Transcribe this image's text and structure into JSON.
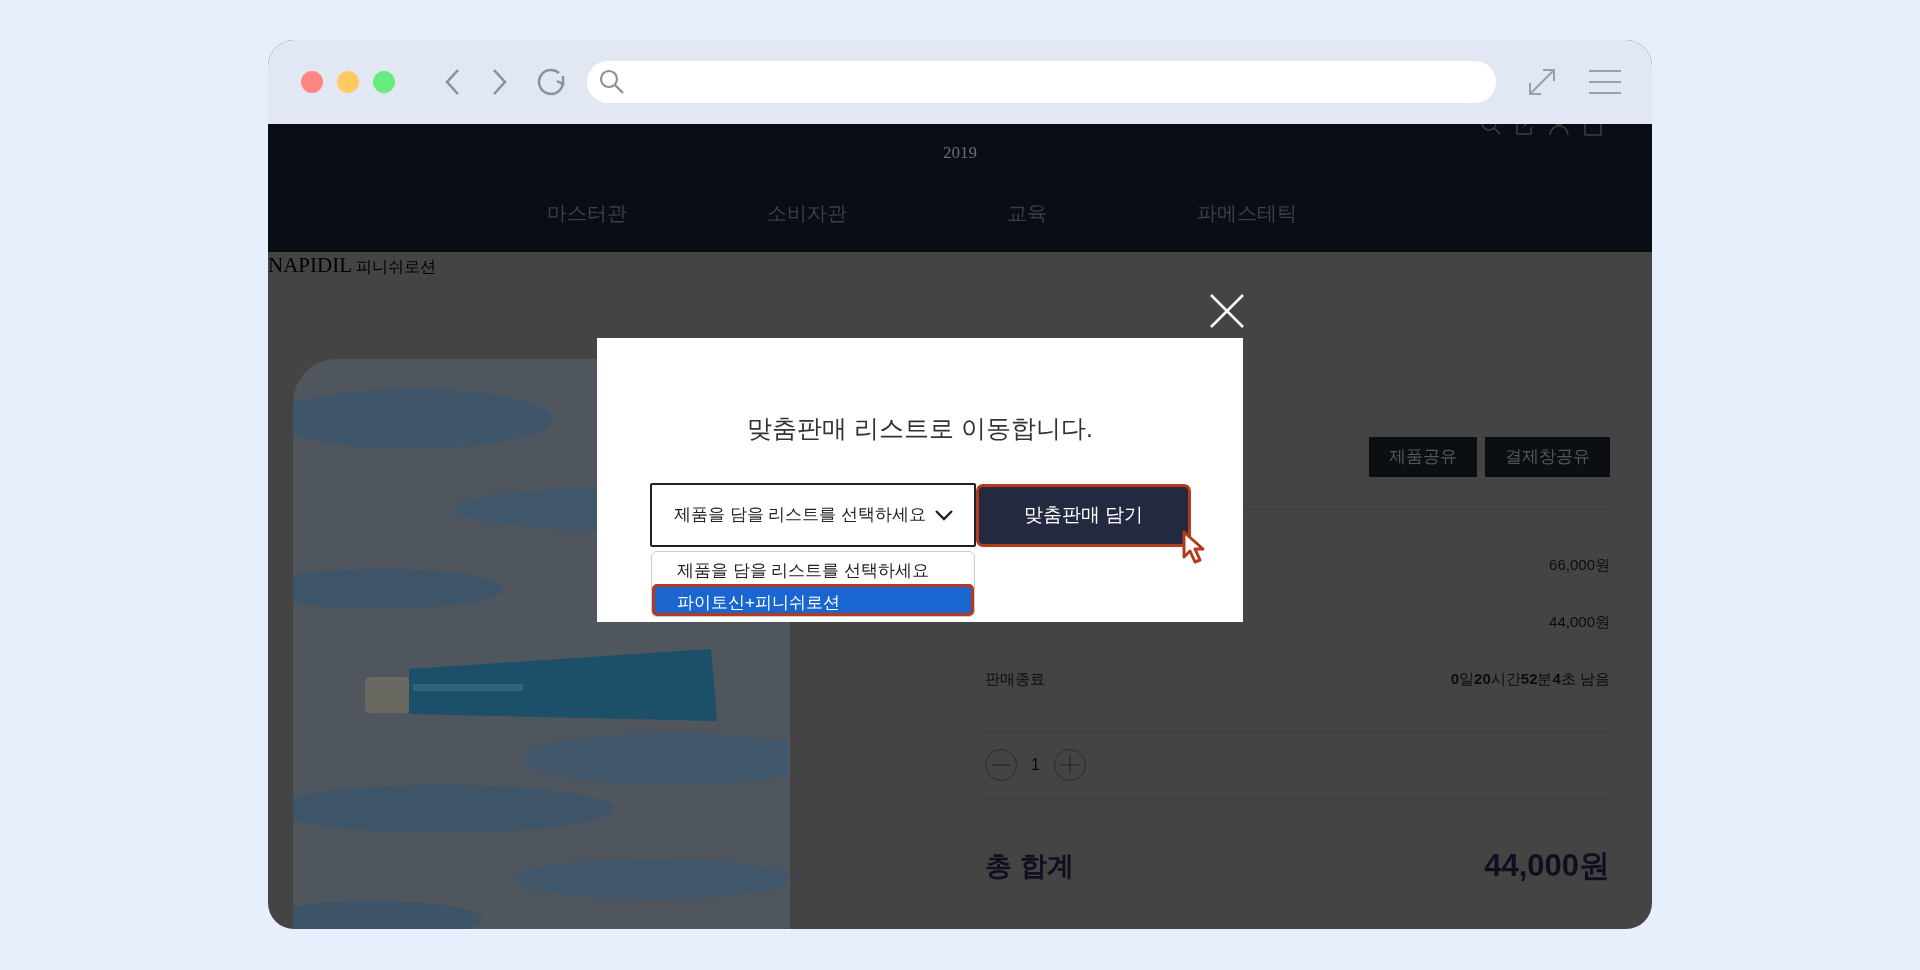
{
  "site_header": {
    "year": "2019",
    "nav": [
      {
        "label": "마스터관"
      },
      {
        "label": "소비자관"
      },
      {
        "label": "교육"
      },
      {
        "label": "파메스테틱"
      }
    ]
  },
  "breadcrumb": {
    "brand": "NAPIDIL",
    "product": "피니쉬로션"
  },
  "product": {
    "share_buttons": [
      "제품공유",
      "결제창공유"
    ],
    "prices": [
      "66,000원",
      "44,000원"
    ],
    "sale_end": {
      "label": "판매종료",
      "countdown": "**0**일**20**시간**52**분**4**초 남음"
    },
    "quantity": "1",
    "total": {
      "label": "총 합계",
      "value": "44,000원"
    }
  },
  "modal": {
    "message": "맞춤판매 리스트로 이동합니다.",
    "select": {
      "value": "제품을 담을 리스트를 선택하세요",
      "expanded": true,
      "options": [
        {
          "label": "제품을 담을 리스트를 선택하세요",
          "highlighted": false
        },
        {
          "label": "파이토신+피니쉬로션",
          "highlighted": true
        }
      ]
    },
    "button": "맞춤판매 담기"
  }
}
